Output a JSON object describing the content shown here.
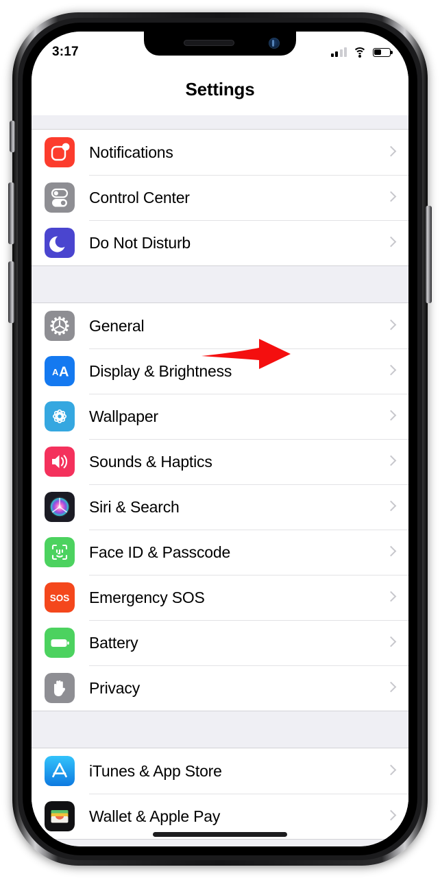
{
  "device": {
    "buttons": [
      {
        "name": "mute-switch"
      },
      {
        "name": "volume-up-button"
      },
      {
        "name": "volume-down-button"
      },
      {
        "name": "power-button"
      }
    ]
  },
  "status_bar": {
    "time": "3:17",
    "signal_bars_total": 4,
    "signal_bars_active": 2,
    "wifi": "wifi-icon",
    "battery_percent": 45
  },
  "header": {
    "title": "Settings"
  },
  "annotation": {
    "type": "arrow",
    "color": "#f40f0f",
    "direction": "right",
    "points_to": "General"
  },
  "colors": {
    "list_background": "#efeff4",
    "row_background": "#ffffff",
    "separator": "#e2e2e5",
    "chevron": "#c7c7cc",
    "label": "#000000"
  },
  "groups": [
    {
      "name": "group-notifications",
      "items": [
        {
          "label": "Notifications",
          "icon": "notifications-icon",
          "icon_color": "#fc3c2d"
        },
        {
          "label": "Control Center",
          "icon": "control-center-icon",
          "icon_color": "#8e8e93"
        },
        {
          "label": "Do Not Disturb",
          "icon": "do-not-disturb-icon",
          "icon_color": "#4a45cf"
        }
      ]
    },
    {
      "name": "group-general",
      "items": [
        {
          "label": "General",
          "icon": "gear-icon",
          "icon_color": "#8e8e93"
        },
        {
          "label": "Display & Brightness",
          "icon": "display-icon",
          "icon_color": "#1479f0"
        },
        {
          "label": "Wallpaper",
          "icon": "wallpaper-icon",
          "icon_color": "#35a7e0"
        },
        {
          "label": "Sounds & Haptics",
          "icon": "sounds-icon",
          "icon_color": "#f4315c"
        },
        {
          "label": "Siri & Search",
          "icon": "siri-icon",
          "icon_color": "#1b1b24"
        },
        {
          "label": "Face ID & Passcode",
          "icon": "face-id-icon",
          "icon_color": "#4cd25f"
        },
        {
          "label": "Emergency SOS",
          "icon": "sos-icon",
          "icon_color": "#f4471c"
        },
        {
          "label": "Battery",
          "icon": "battery-icon",
          "icon_color": "#4cd25f"
        },
        {
          "label": "Privacy",
          "icon": "privacy-hand-icon",
          "icon_color": "#8e8e93"
        }
      ]
    },
    {
      "name": "group-stores",
      "items": [
        {
          "label": "iTunes & App Store",
          "icon": "app-store-icon",
          "icon_color": "#1aaaf0"
        },
        {
          "label": "Wallet & Apple Pay",
          "icon": "wallet-icon",
          "icon_color": "#111113"
        }
      ]
    }
  ]
}
